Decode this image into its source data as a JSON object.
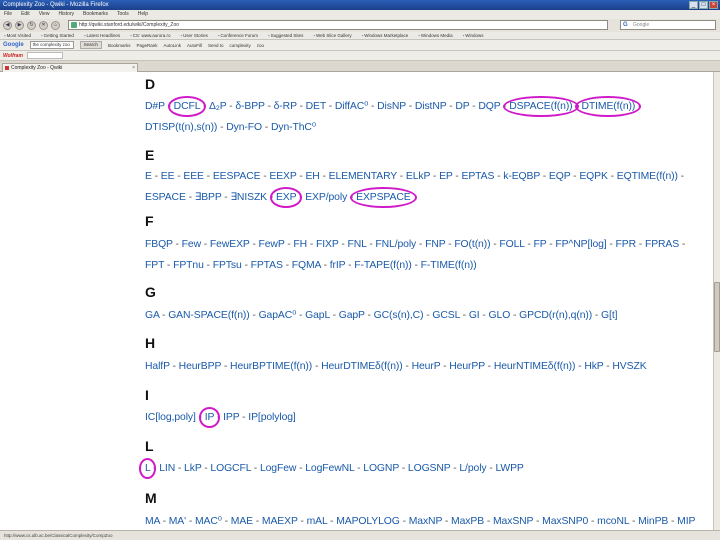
{
  "window": {
    "title": "Complexity Zoo - Qwiki - Mozilla Firefox",
    "controls": [
      "_",
      "□",
      "×"
    ]
  },
  "menu": [
    "File",
    "Edit",
    "View",
    "History",
    "Bookmarks",
    "Tools",
    "Help"
  ],
  "nav": {
    "url": "http://qwiki.stanford.edu/wiki/Complexity_Zoo",
    "search_placeholder": "Google"
  },
  "bookmarks": [
    "Most Visited",
    "Getting Started",
    "Latest Headlines",
    "CS: www.aurora.ro",
    "User Stories",
    "Conference Forum",
    "Suggested Sites",
    "Web Slice Gallery",
    "Windows Marketplace",
    "Windows Media",
    "Windows"
  ],
  "googlebar": {
    "label": "Google",
    "query": "the complexity zoo",
    "search_btn": "Search",
    "items": [
      "Bookmarks",
      "PageRank",
      "AutoLink",
      "AutoFill",
      "Send to",
      "complexity",
      "zoo"
    ]
  },
  "wolfram": {
    "label": "Wolfram"
  },
  "tab": {
    "title": "Complexity Zoo - Qwiki"
  },
  "status": "http://www.cs.ulb.ac.be/ClassicalComplexity/CompZoo",
  "accent": "#d019c8",
  "link_color": "#1a5aa8",
  "sections": [
    {
      "letter": "D",
      "lines": [
        [
          "D#P",
          "DCFL",
          "Δ₂P",
          "δ-BPP",
          "δ-RP",
          "DET",
          "DiffAC⁰",
          "DisNP",
          "DistNP",
          "DP",
          "DQP",
          "DSPACE(f(n))",
          "DTIME(f(n))"
        ],
        [
          "DTISP(t(n),s(n))",
          "Dyn-FO",
          "Dyn-ThC⁰"
        ]
      ]
    },
    {
      "letter": "E",
      "lines": [
        [
          "E",
          "EE",
          "EEE",
          "EESPACE",
          "EEXP",
          "EH",
          "ELEMENTARY",
          "ELkP",
          "EP",
          "EPTAS",
          "k-EQBP",
          "EQP",
          "EQPK",
          "EQTIME(f(n))"
        ],
        [
          "ESPACE",
          "∃BPP",
          "∃NISZK",
          "EXP",
          "EXP/poly",
          "EXPSPACE"
        ]
      ]
    },
    {
      "letter": "F",
      "lines": [
        [
          "FBQP",
          "Few",
          "FewEXP",
          "FewP",
          "FH",
          "FIXP",
          "FNL",
          "FNL/poly",
          "FNP",
          "FO(t(n))",
          "FOLL",
          "FP",
          "FP^NP[log]",
          "FPR",
          "FPRAS"
        ],
        [
          "FPT",
          "FPTnu",
          "FPTsu",
          "FPTAS",
          "FQMA",
          "frIP",
          "F-TAPE(f(n))",
          "F-TIME(f(n))"
        ]
      ]
    },
    {
      "letter": "G",
      "lines": [
        [
          "GA",
          "GAN-SPACE(f(n))",
          "GapAC⁰",
          "GapL",
          "GapP",
          "GC(s(n),C)",
          "GCSL",
          "GI",
          "GLO",
          "GPCD(r(n),q(n))",
          "G[t]"
        ]
      ]
    },
    {
      "letter": "H",
      "lines": [
        [
          "HalfP",
          "HeurBPP",
          "HeurBPTIME(f(n))",
          "HeurDTIMEδ(f(n))",
          "HeurP",
          "HeurPP",
          "HeurNTIMEδ(f(n))",
          "HkP",
          "HVSZK"
        ]
      ]
    },
    {
      "letter": "I",
      "lines": [
        [
          "IC[log,poly]",
          "IP",
          "IPP",
          "IP[polylog]"
        ]
      ]
    },
    {
      "letter": "L",
      "lines": [
        [
          "L",
          "LIN",
          "LkP",
          "LOGCFL",
          "LogFew",
          "LogFewNL",
          "LOGNP",
          "LOGSNP",
          "L/poly",
          "LWPP"
        ]
      ]
    },
    {
      "letter": "M",
      "lines": [
        [
          "MA",
          "MA'",
          "MAC⁰",
          "MAE",
          "MAEXP",
          "mAL",
          "MAPOLYLOG",
          "MaxNP",
          "MaxPB",
          "MaxSNP",
          "MaxSNP0",
          "mcoNL",
          "MinPB",
          "MIP"
        ]
      ]
    }
  ]
}
